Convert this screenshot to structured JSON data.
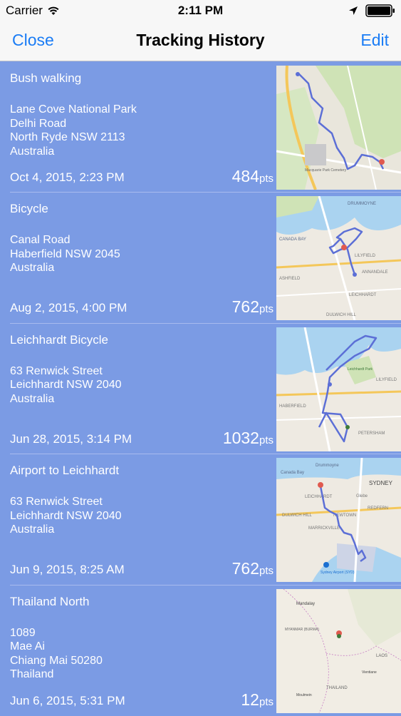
{
  "status_bar": {
    "carrier": "Carrier",
    "time": "2:11 PM",
    "wifi_icon": "wifi-icon",
    "location_icon": "location-arrow-icon",
    "battery_icon": "battery-icon"
  },
  "nav": {
    "close_label": "Close",
    "title": "Tracking History",
    "edit_label": "Edit"
  },
  "colors": {
    "accent": "#1a7cf5",
    "row_background": "#7b9be4",
    "route_line": "#5c6fd6"
  },
  "tracks": [
    {
      "name": "Bush walking",
      "address": [
        "Lane Cove National Park",
        "Delhi Road",
        "North Ryde NSW 2113",
        "Australia"
      ],
      "date": "Oct 4, 2015, 2:23 PM",
      "points": "484",
      "points_unit": "pts"
    },
    {
      "name": "Bicycle",
      "address": [
        "Canal Road",
        "Haberfield NSW 2045",
        "Australia"
      ],
      "date": "Aug 2, 2015, 4:00 PM",
      "points": "762",
      "points_unit": "pts"
    },
    {
      "name": "Leichhardt Bicycle",
      "address": [
        "63 Renwick Street",
        "Leichhardt NSW 2040",
        "Australia"
      ],
      "date": "Jun 28, 2015, 3:14 PM",
      "points": "1032",
      "points_unit": "pts"
    },
    {
      "name": "Airport to Leichhardt",
      "address": [
        "63 Renwick Street",
        "Leichhardt NSW 2040",
        "Australia"
      ],
      "date": "Jun 9, 2015, 8:25 AM",
      "points": "762",
      "points_unit": "pts"
    },
    {
      "name": "Thailand North",
      "address": [
        "1089",
        "Mae Ai",
        "Chiang Mai 50280",
        "Thailand"
      ],
      "date": "Jun 6, 2015, 5:31 PM",
      "points": "12",
      "points_unit": "pts"
    }
  ],
  "map_labels": {
    "map1": [
      "Macquarie Park Cemetery"
    ],
    "map2": [
      "DRUMMOYNE",
      "CANADA BAY",
      "LILYFIELD",
      "ASHFIELD",
      "LEICHHARDT",
      "ANNANDALE",
      "DULWICH HILL"
    ],
    "map3": [
      "Leichhardt Park",
      "LILYFIELD",
      "HABERFIELD",
      "PETERSHAM"
    ],
    "map4": [
      "Drummoyne",
      "Canada Bay",
      "SYDNEY",
      "Glebe",
      "LEICHHARDT",
      "REDFERN",
      "DULWICH HILL",
      "NEWTOWN",
      "MARRICKVILLE",
      "Sydney Airport (SYD)"
    ],
    "map5": [
      "Mandalay",
      "MYANMAR (BURMA)",
      "LAOS",
      "Vientiane",
      "THAILAND",
      "Moulmein"
    ]
  }
}
